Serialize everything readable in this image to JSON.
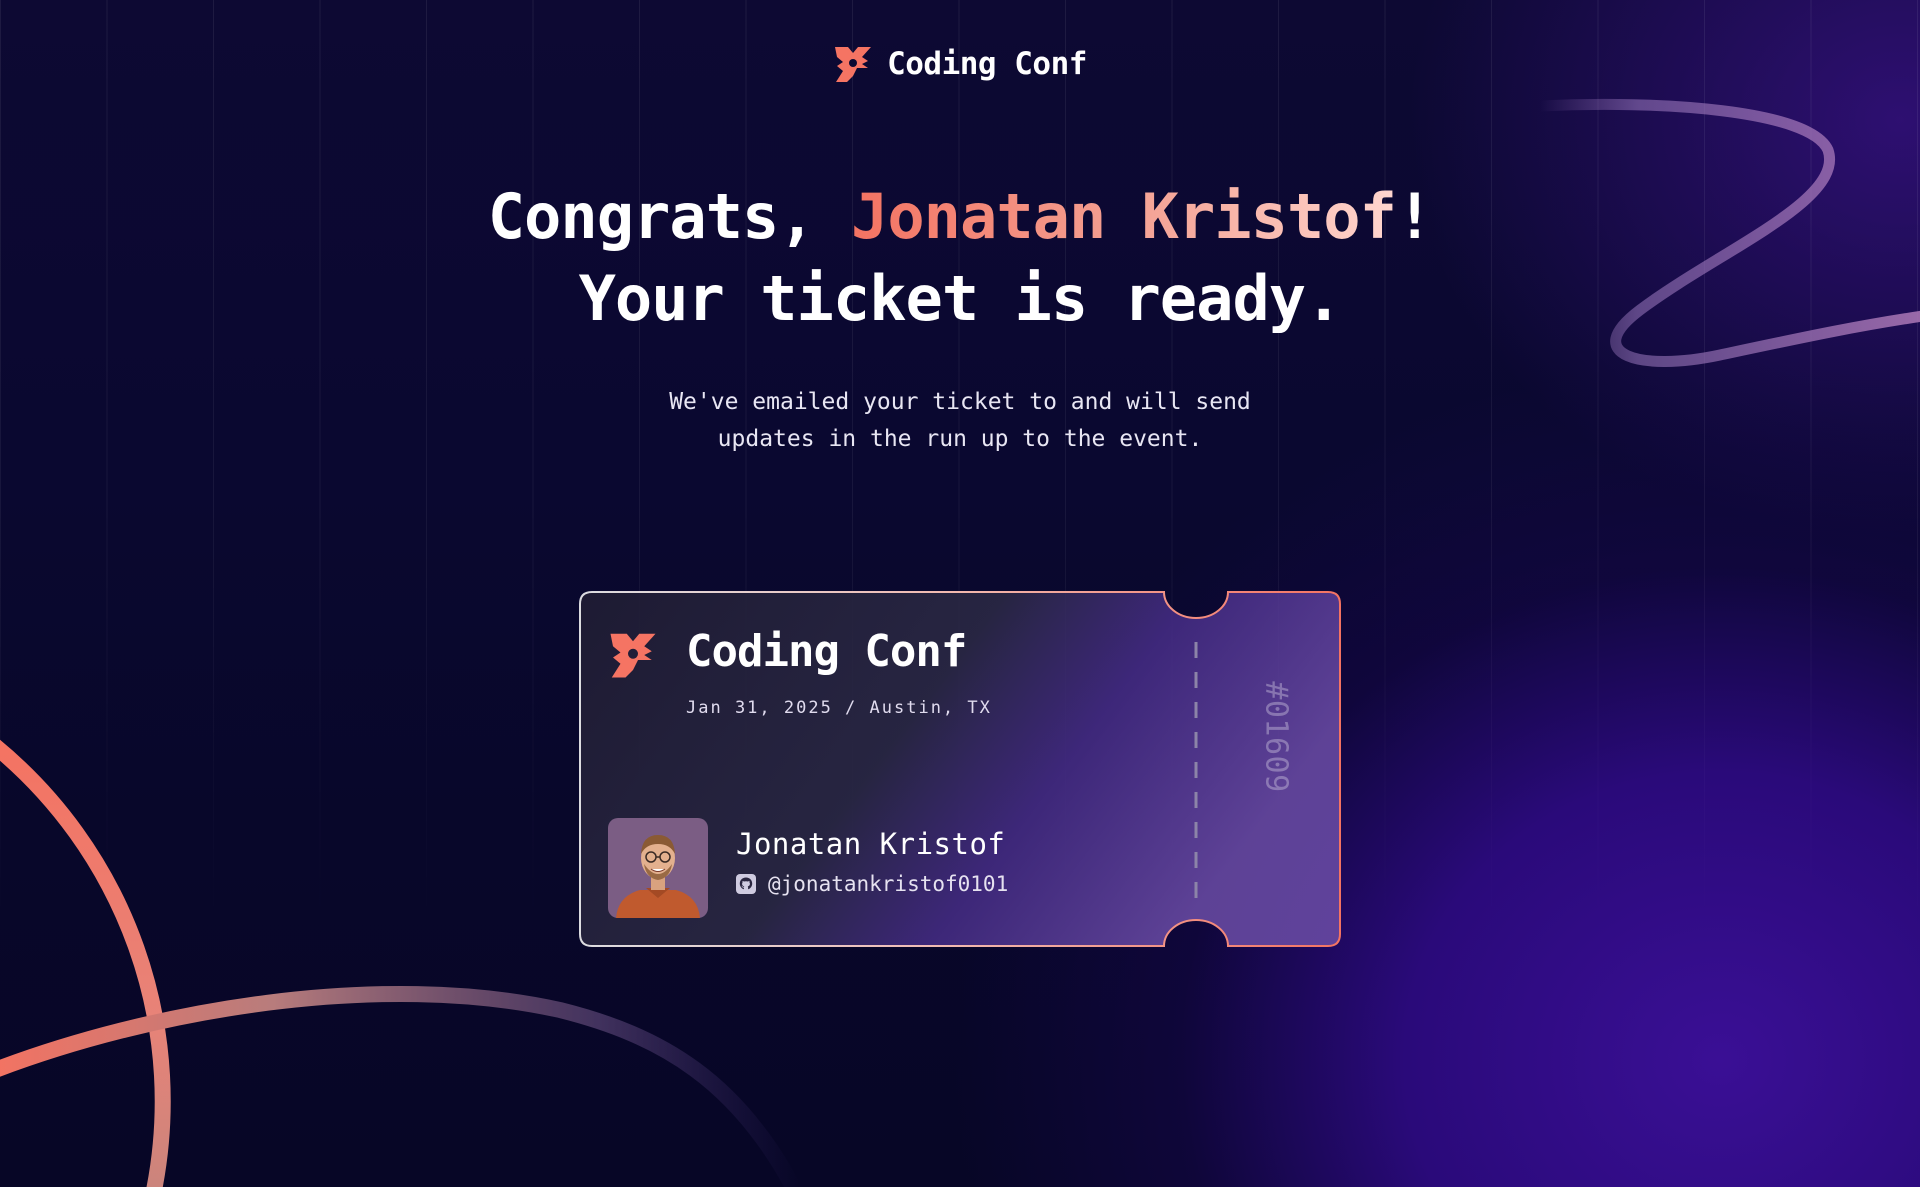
{
  "brand": {
    "name": "Coding Conf",
    "logo_icon": "coding-conf-logo-icon",
    "accent_color": "#f57463"
  },
  "headline": {
    "prefix": "Congrats, ",
    "name": "Jonatan Kristof",
    "suffix": "!",
    "line2": "Your ticket is ready."
  },
  "subtext": {
    "line1": "We've emailed your ticket to and will send",
    "line2": "updates in the run up to the event."
  },
  "ticket": {
    "brand": "Coding Conf",
    "event_info": "Jan 31, 2025 / Austin, TX",
    "attendee_name": "Jonatan Kristof",
    "github_icon": "github-icon",
    "github_handle": "@jonatankristof0101",
    "ticket_number": "#01609",
    "border_color": "#f38f7f"
  }
}
